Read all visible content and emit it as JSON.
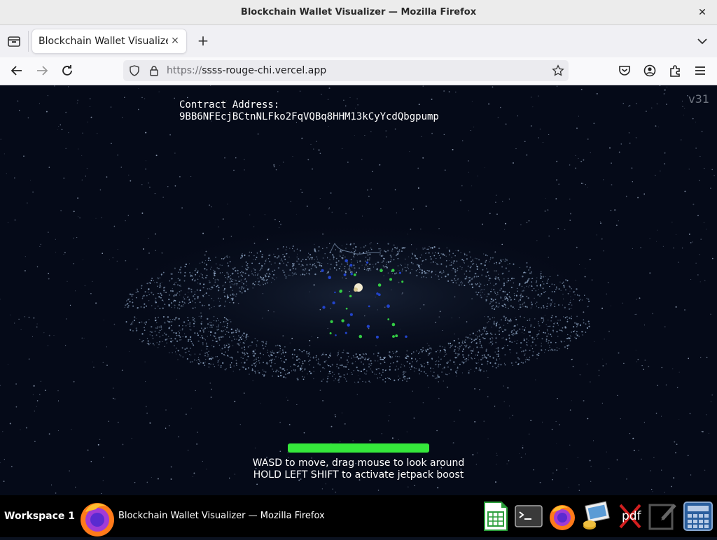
{
  "window": {
    "title": "Blockchain Wallet Visualizer — Mozilla Firefox",
    "close_glyph": "✕"
  },
  "tabs": [
    {
      "label": "Blockchain Wallet Visualizer",
      "close_glyph": "×",
      "active": true
    }
  ],
  "tabstrip": {
    "new_tab_glyph": "+"
  },
  "navbar": {
    "url_protocol": "https://",
    "url_host": "ssss-rouge-chi.vercel.app"
  },
  "page": {
    "contract_label": "Contract Address:",
    "contract_address": "9BB6NFEcjBCtnNLFko2FqVQBq8HHM13kCyYcdQbgpump",
    "version": "v31",
    "boost_level": 1.0,
    "help_line_1": "WASD to move, drag mouse to look around",
    "help_line_2": "HOLD LEFT SHIFT to activate jetpack boost",
    "colors": {
      "background": "#050a18",
      "stars": "#b8c8e0",
      "ring": "#9fb8d8",
      "nodes_green": "#33cc44",
      "nodes_blue": "#2244cc",
      "boost": "#35e83b"
    }
  },
  "taskbar": {
    "workspace": "Workspace 1",
    "window_title": "Blockchain Wallet Visualizer — Mozilla Firefox",
    "tray_icons": [
      "spreadsheet-icon",
      "terminal-icon",
      "firefox-icon",
      "image-viewer-icon",
      "pdf-icon",
      "text-editor-icon",
      "calculator-icon"
    ],
    "pdf_label": "pdf"
  }
}
